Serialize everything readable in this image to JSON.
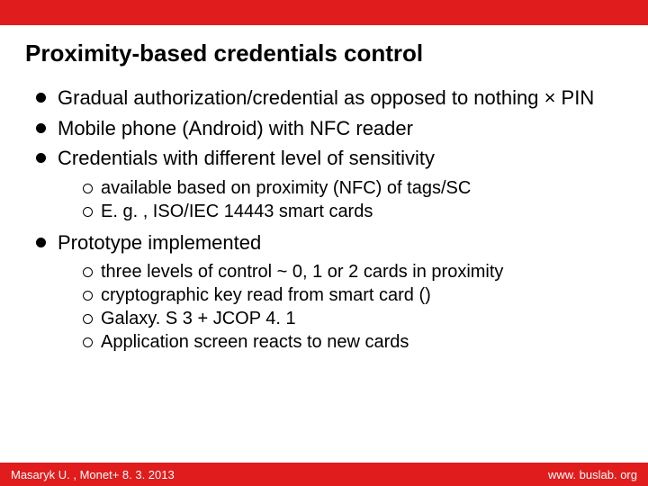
{
  "title": "Proximity-based credentials control",
  "bullets": {
    "b0": "Gradual authorization/credential as opposed to nothing × PIN",
    "b1": "Mobile phone (Android) with NFC reader",
    "b2": "Credentials with different level of sensitivity",
    "b2_sub0": "available based on proximity (NFC) of tags/SC",
    "b2_sub1": "E. g. , ISO/IEC 14443 smart cards",
    "b3": "Prototype implemented",
    "b3_sub0": "three levels of control ~ 0, 1 or 2 cards in proximity",
    "b3_sub1": "cryptographic key read from smart card ()",
    "b3_sub2": "Galaxy. S 3 + JCOP 4. 1",
    "b3_sub3": "Application screen reacts to new cards"
  },
  "footer": {
    "left": "Masaryk U. , Monet+ 8. 3. 2013",
    "right": "www. buslab. org"
  }
}
